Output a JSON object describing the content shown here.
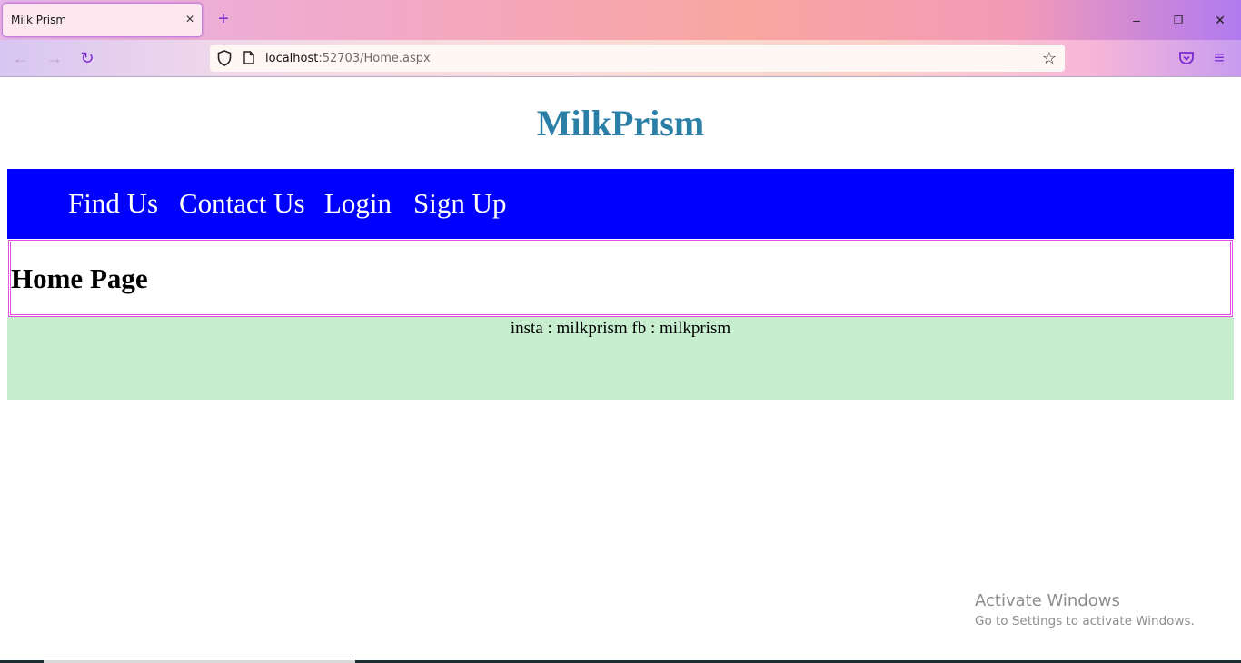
{
  "browser": {
    "tab_title": "Milk Prism",
    "tab_close_glyph": "×",
    "new_tab_glyph": "+",
    "url_host": "localhost",
    "url_rest": ":52703/Home.aspx",
    "icons": {
      "back": "back-arrow-icon",
      "forward": "forward-arrow-icon",
      "reload": "reload-icon",
      "shield": "tracking-shield-icon",
      "page": "page-icon",
      "star": "bookmark-star-icon",
      "pocket": "pocket-icon",
      "menu": "hamburger-menu-icon",
      "minimize": "minimize-icon",
      "restore": "restore-icon",
      "close": "window-close-icon"
    },
    "glyphs": {
      "back": "←",
      "forward": "→",
      "reload": "↻",
      "star": "☆",
      "menu": "≡",
      "minimize": "–",
      "restore": "❐",
      "close": "✕"
    },
    "accent_color": "#7a2bd0"
  },
  "site": {
    "title": "MilkPrism",
    "title_color": "#2a7fa6",
    "nav": {
      "background": "#0000ff",
      "items": [
        {
          "label": "Find Us"
        },
        {
          "label": "Contact Us"
        },
        {
          "label": "Login"
        },
        {
          "label": "Sign Up"
        }
      ]
    },
    "content": {
      "heading": "Home Page",
      "border_color": "#e64ce6"
    },
    "footer": {
      "text": "insta : milkprism fb : milkprism",
      "background": "#c6eecf"
    }
  },
  "os_overlay": {
    "activate_title": "Activate Windows",
    "activate_subtitle": "Go to Settings to activate Windows."
  }
}
